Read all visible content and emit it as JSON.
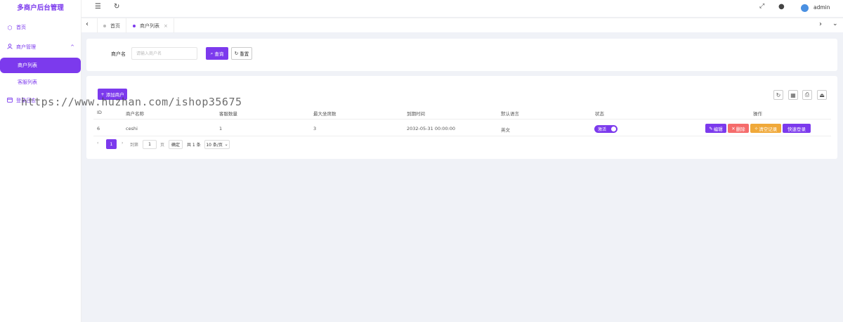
{
  "app": {
    "title": "多商户后台管理"
  },
  "colors": {
    "accent": "#7c3aed",
    "danger": "#f56c6c",
    "warning": "#f0a93a"
  },
  "sidebar": {
    "items": [
      {
        "label": "首页",
        "icon": "home-icon"
      },
      {
        "label": "商户管理",
        "icon": "user-icon",
        "expanded": true,
        "children": [
          {
            "label": "商户列表",
            "active": true
          },
          {
            "label": "客服列表"
          }
        ]
      },
      {
        "label": "登录日志",
        "icon": "calendar-icon"
      }
    ]
  },
  "header": {
    "username": "admin",
    "icons": [
      "menu-fold-icon",
      "refresh-icon",
      "fullscreen-icon",
      "globe-icon",
      "avatar"
    ]
  },
  "tabs": [
    {
      "label": "首页"
    },
    {
      "label": "商户列表",
      "active": true,
      "closable": true
    }
  ],
  "search": {
    "label": "商户名",
    "placeholder": "请输入商户名",
    "value": "",
    "query_label": "查询",
    "reset_label": "重置"
  },
  "table": {
    "add_label": "添加商户",
    "columns": [
      "ID",
      "商户名称",
      "客服数量",
      "最大坐席数",
      "到期时间",
      "默认语言",
      "状态",
      "操作"
    ],
    "rows": [
      {
        "id": "6",
        "name": "ceshi",
        "service_count": "1",
        "max_seats": "3",
        "expire": "2032-05-31 00:00:00",
        "language": "英文",
        "status": "激活",
        "status_on": true
      }
    ],
    "actions": {
      "edit": "编辑",
      "delete": "删除",
      "clear": "清空记录",
      "login": "快速登录"
    }
  },
  "pagination": {
    "current": "1",
    "goto_prefix": "到第",
    "goto_value": "1",
    "goto_suffix": "页",
    "confirm": "确定",
    "total": "共 1 条",
    "page_size": "10 条/页"
  },
  "watermark": "https://www.huzhan.com/ishop35675"
}
